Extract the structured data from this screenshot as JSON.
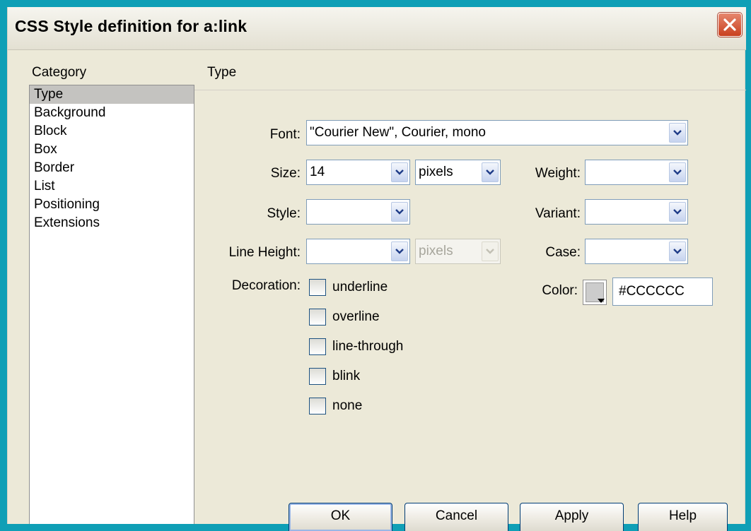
{
  "dialog": {
    "title": "CSS Style definition for a:link",
    "close_icon": "close-icon"
  },
  "category": {
    "label": "Category",
    "items": [
      "Type",
      "Background",
      "Block",
      "Box",
      "Border",
      "List",
      "Positioning",
      "Extensions"
    ],
    "selected": "Type"
  },
  "section": {
    "title": "Type"
  },
  "fields": {
    "font": {
      "label": "Font:",
      "value": "\"Courier New\", Courier, mono"
    },
    "size": {
      "label": "Size:",
      "value": "14",
      "unit": "pixels"
    },
    "weight": {
      "label": "Weight:",
      "value": ""
    },
    "style": {
      "label": "Style:",
      "value": ""
    },
    "variant": {
      "label": "Variant:",
      "value": ""
    },
    "line_height": {
      "label": "Line Height:",
      "value": "",
      "unit": "pixels"
    },
    "case": {
      "label": "Case:",
      "value": ""
    },
    "decoration": {
      "label": "Decoration:",
      "options": [
        "underline",
        "overline",
        "line-through",
        "blink",
        "none"
      ]
    },
    "color": {
      "label": "Color:",
      "value": "#CCCCCC",
      "swatch": "#cccccc"
    }
  },
  "buttons": {
    "ok": "OK",
    "cancel": "Cancel",
    "apply": "Apply",
    "help": "Help"
  },
  "theme": {
    "accent": "#0f9fb6",
    "close_red": "#c9401f"
  }
}
